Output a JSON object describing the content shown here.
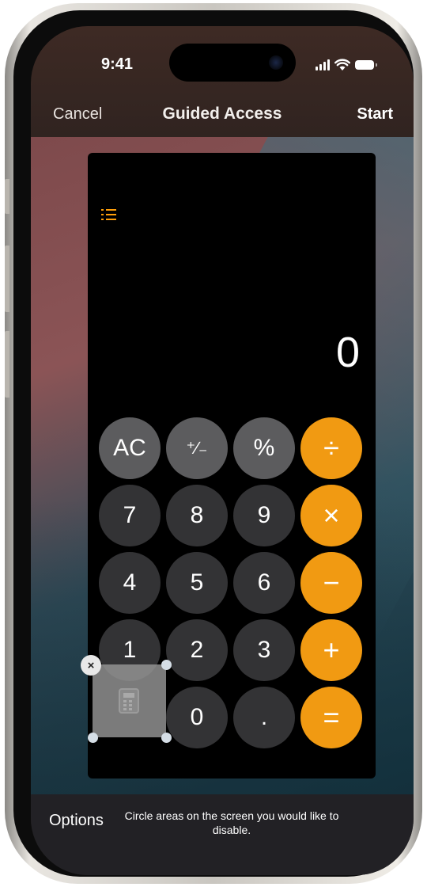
{
  "status_bar": {
    "time": "9:41"
  },
  "nav": {
    "cancel": "Cancel",
    "title": "Guided Access",
    "start": "Start"
  },
  "calculator": {
    "display_value": "0",
    "rows": [
      [
        {
          "label": "AC",
          "kind": "fn"
        },
        {
          "label": "⁺∕₋",
          "kind": "fn"
        },
        {
          "label": "%",
          "kind": "fn"
        },
        {
          "label": "÷",
          "kind": "op"
        }
      ],
      [
        {
          "label": "7",
          "kind": "num"
        },
        {
          "label": "8",
          "kind": "num"
        },
        {
          "label": "9",
          "kind": "num"
        },
        {
          "label": "×",
          "kind": "op"
        }
      ],
      [
        {
          "label": "4",
          "kind": "num"
        },
        {
          "label": "5",
          "kind": "num"
        },
        {
          "label": "6",
          "kind": "num"
        },
        {
          "label": "−",
          "kind": "op"
        }
      ],
      [
        {
          "label": "1",
          "kind": "num"
        },
        {
          "label": "2",
          "kind": "num"
        },
        {
          "label": "3",
          "kind": "num"
        },
        {
          "label": "+",
          "kind": "op"
        }
      ],
      [
        {
          "label": "",
          "kind": "covered"
        },
        {
          "label": "0",
          "kind": "num"
        },
        {
          "label": ".",
          "kind": "num"
        },
        {
          "label": "=",
          "kind": "op"
        }
      ]
    ]
  },
  "bottom_bar": {
    "options": "Options",
    "hint": "Circle areas on the screen you would like to disable."
  },
  "colors": {
    "operator": "#f19a12",
    "function": "#5c5c5e",
    "number": "#333335"
  }
}
